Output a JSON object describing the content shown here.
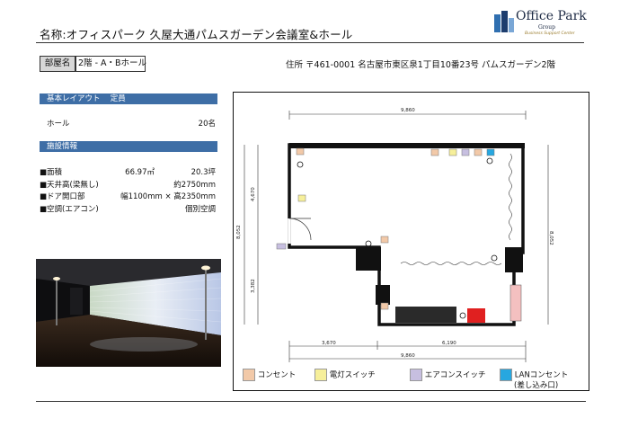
{
  "header": {
    "title": "名称:オフィスパーク 久屋大通パムスガーデン会議室&ホール",
    "logo_line1": "Office Park",
    "logo_line2": "Group",
    "logo_line3": "Business Support Center"
  },
  "room": {
    "label": "部屋名",
    "value": "2階 - A・Bホール",
    "address": "住所 〒461-0001 名古屋市東区泉1丁目10番23号 パムスガーデン2階"
  },
  "layout_section": {
    "header": "基本レイアウト　 定員",
    "rows": [
      {
        "label": "ホール",
        "value": "20名"
      }
    ]
  },
  "facility_section": {
    "header": "施設情報",
    "rows": [
      {
        "label": "■面積",
        "mid": "66.97㎡",
        "value": "20.3坪"
      },
      {
        "label": "■天井高(梁無し)",
        "mid": "",
        "value": "約2750mm"
      },
      {
        "label": "■ドア開口部",
        "mid": "",
        "value": "幅1100mm × 高2350mm"
      },
      {
        "label": "■空調(エアコン)",
        "mid": "",
        "value": "個別空調"
      }
    ]
  },
  "floorplan": {
    "dim_top": "9,860",
    "dim_bottom_left": "3,670",
    "dim_bottom_right": "6,190",
    "dim_bottom_total": "9,860",
    "dim_left_outer": "8,052",
    "dim_left_upper": "4,670",
    "dim_left_lower": "3,382",
    "dim_right": "8,052"
  },
  "legend": [
    {
      "icon": "outlet-icon",
      "label": "コンセント",
      "color": "#f2c9a8"
    },
    {
      "icon": "light-switch-icon",
      "label": "電灯スイッチ",
      "color": "#f6ef9a"
    },
    {
      "icon": "aircon-switch-icon",
      "label": "エアコンスイッチ",
      "color": "#c7bfe0"
    },
    {
      "icon": "lan-outlet-icon",
      "label": "LANコンセント",
      "sublabel": "(差し込み口)",
      "color": "#27a7e0"
    }
  ]
}
